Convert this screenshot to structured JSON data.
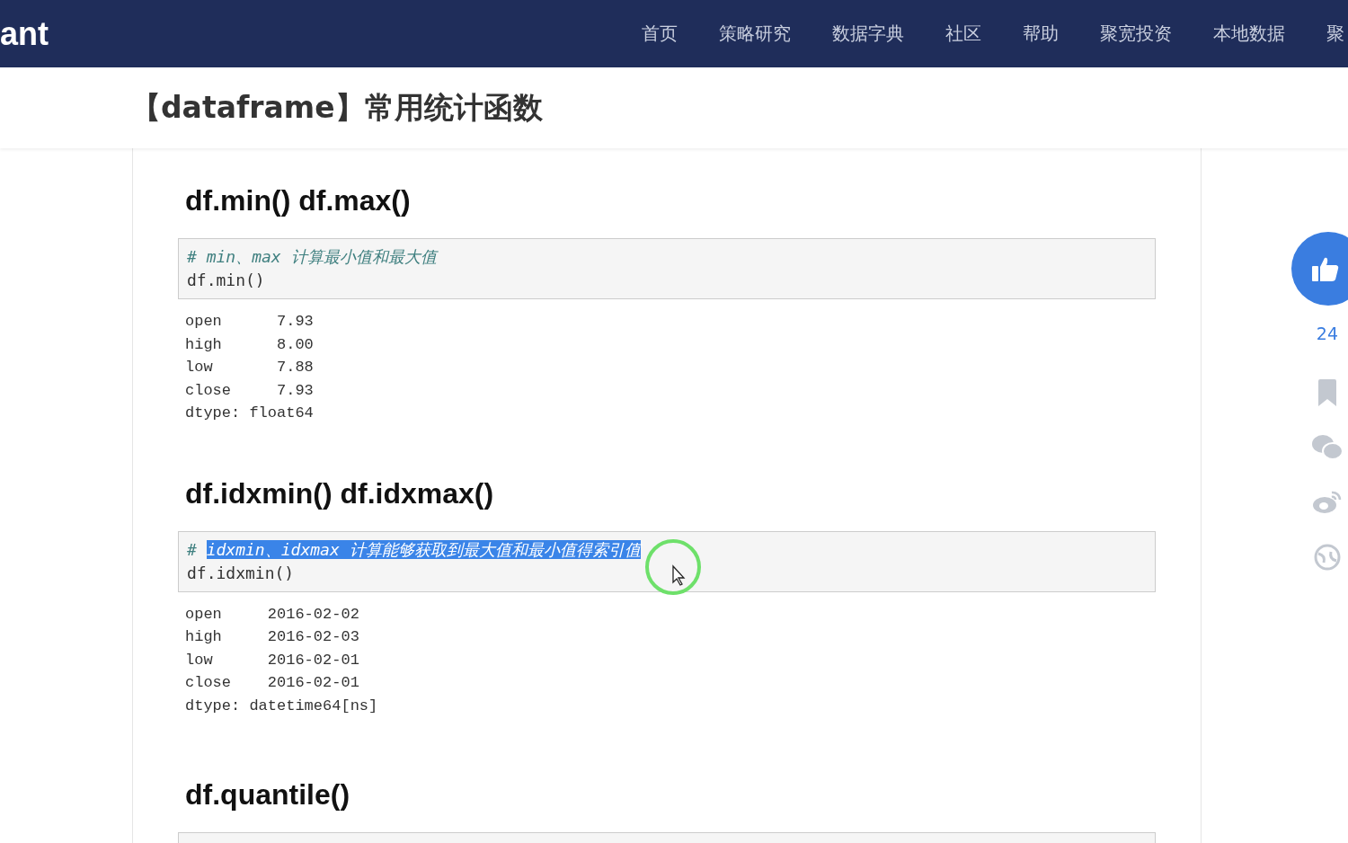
{
  "nav": {
    "logo": "ant",
    "items": [
      "首页",
      "策略研究",
      "数据字典",
      "社区",
      "帮助",
      "聚宽投资",
      "本地数据",
      "聚"
    ]
  },
  "title": "【dataframe】常用统计函数",
  "sections": [
    {
      "heading": "df.min() df.max()",
      "code": {
        "kind": "full",
        "comment_mark": "#",
        "comment_parts": [
          {
            "text": "min、max 计算最小值和最大值",
            "selected": false
          }
        ],
        "lines": [
          "df.min()"
        ]
      },
      "output": [
        "open      7.93",
        "high      8.00",
        "low       7.88",
        "close     7.93",
        "dtype: float64"
      ]
    },
    {
      "heading": "df.idxmin() df.idxmax()",
      "code": {
        "kind": "full",
        "comment_mark": "#",
        "comment_parts": [
          {
            "text": "idxmin、idxmax 计算能够获取到最大值和最小值得索引值",
            "selected": true
          }
        ],
        "lines": [
          "df.idxmin()"
        ]
      },
      "output": [
        "open     2016-02-02",
        "high     2016-02-03",
        "low      2016-02-01",
        "close    2016-02-01",
        "dtype: datetime64[ns]"
      ]
    },
    {
      "heading": "df.quantile()",
      "code": {
        "kind": "clipped"
      }
    }
  ],
  "sidebar": {
    "likes": "24"
  }
}
